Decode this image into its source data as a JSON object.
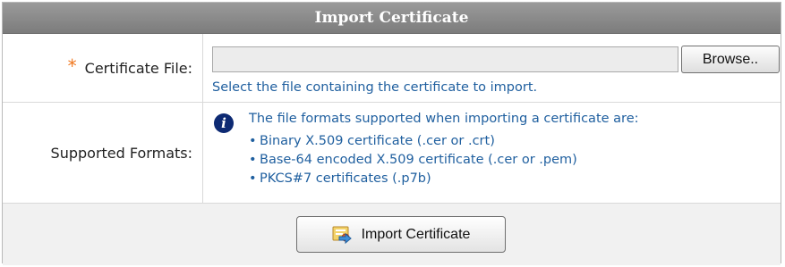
{
  "panel": {
    "title": "Import Certificate"
  },
  "file_row": {
    "required_marker": "*",
    "label": "Certificate File:",
    "file_value": "",
    "browse_label": "Browse..",
    "hint": "Select the file containing the certificate to import."
  },
  "formats_row": {
    "label": "Supported Formats:",
    "info_icon": "info-icon",
    "intro": "The file formats supported when importing a certificate are:",
    "items": [
      "Binary X.509 certificate (.cer or .crt)",
      "Base-64 encoded X.509 certificate (.cer or .pem)",
      "PKCS#7 certificates (.p7b)"
    ]
  },
  "footer": {
    "import_button_label": "Import Certificate",
    "import_button_icon": "certificate-import-icon"
  },
  "colors": {
    "header_bg": "#8a8a8a",
    "required_star": "#f07820",
    "link_text": "#1f5f9f",
    "info_icon_bg": "#0d2a73"
  }
}
